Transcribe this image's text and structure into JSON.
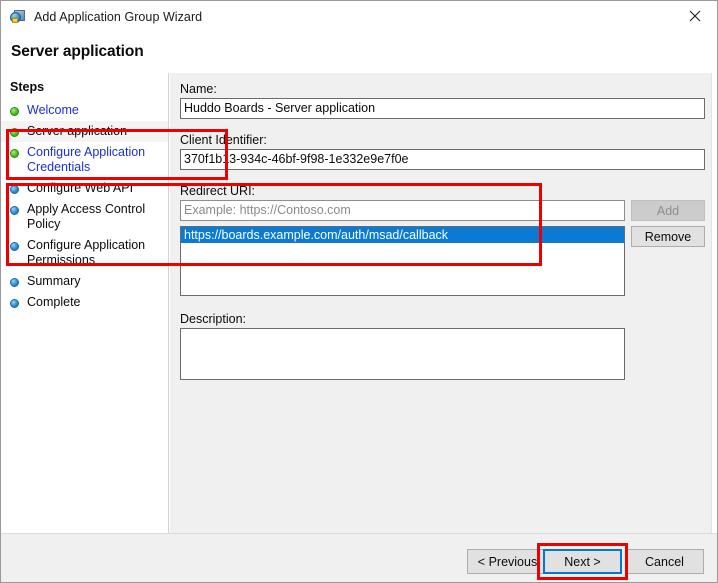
{
  "window": {
    "title": "Add Application Group Wizard",
    "app_icon": "application-group-icon",
    "close_icon": "close-icon",
    "header_title": "Server application"
  },
  "sidebar": {
    "heading": "Steps",
    "items": [
      {
        "label": "Welcome",
        "state": "done",
        "style": "link"
      },
      {
        "label": "Server application",
        "state": "done",
        "style": "current"
      },
      {
        "label": "Configure Application Credentials",
        "state": "done",
        "style": "link"
      },
      {
        "label": "Configure Web API",
        "state": "pending",
        "style": "plain"
      },
      {
        "label": "Apply Access Control Policy",
        "state": "pending",
        "style": "plain"
      },
      {
        "label": "Configure Application Permissions",
        "state": "pending",
        "style": "plain"
      },
      {
        "label": "Summary",
        "state": "pending",
        "style": "plain"
      },
      {
        "label": "Complete",
        "state": "pending",
        "style": "plain"
      }
    ]
  },
  "form": {
    "name_label": "Name:",
    "name_value": "Huddo Boards - Server application",
    "client_id_label": "Client Identifier:",
    "client_id_value": "370f1b13-934c-46bf-9f98-1e332e9e7f0e",
    "redirect_label": "Redirect URI:",
    "redirect_placeholder": "Example: https://Contoso.com",
    "add_label": "Add",
    "remove_label": "Remove",
    "redirect_uris": [
      "https://boards.example.com/auth/msad/callback"
    ],
    "description_label": "Description:",
    "description_value": ""
  },
  "footer": {
    "previous_label": "< Previous",
    "next_label": "Next >",
    "cancel_label": "Cancel"
  },
  "colors": {
    "accent": "#0078d7",
    "selection": "#0b7ad5",
    "annotation": "#ee0000",
    "link": "#1a2fdc",
    "step_done": "#4cc227",
    "step_pending": "#2e8fd6",
    "panel_bg": "#f0f0f0"
  }
}
